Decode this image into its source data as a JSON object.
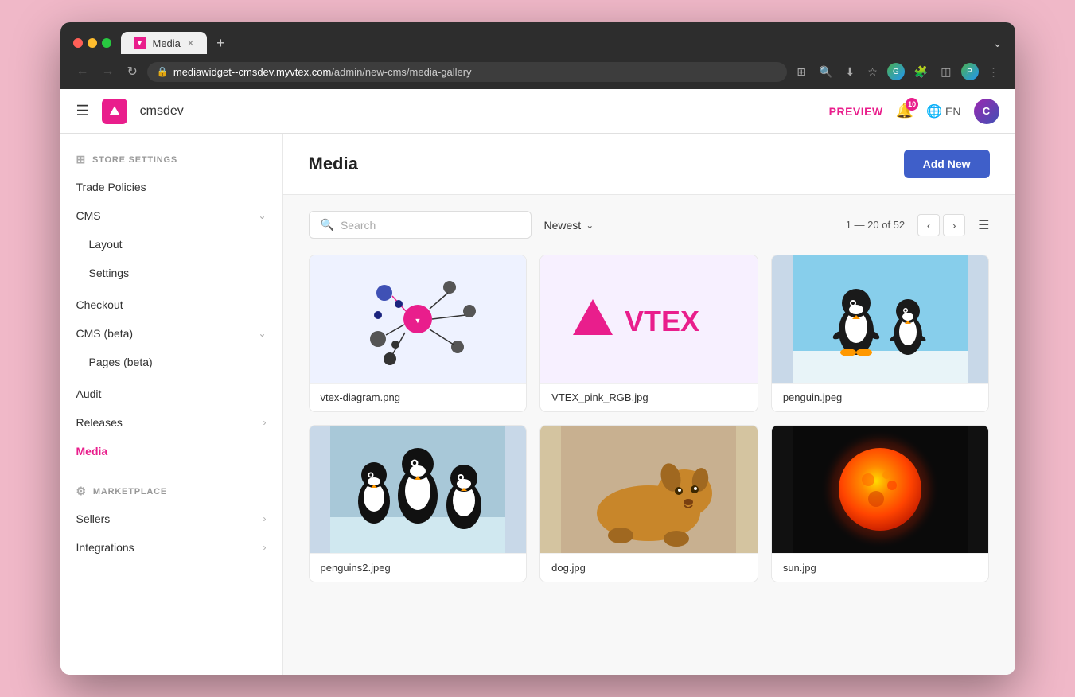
{
  "browser": {
    "tab_title": "Media",
    "tab_favicon": "▼",
    "url_domain": "mediawidget--cmsdev.myvtex.com",
    "url_path": "/admin/new-cms/media-gallery",
    "new_tab_icon": "+",
    "expand_icon": "⌄"
  },
  "nav": {
    "hamburger": "☰",
    "brand_name": "cmsdev",
    "preview_label": "PREVIEW",
    "notification_count": "10",
    "language": "EN",
    "user_initial": "C"
  },
  "sidebar": {
    "store_settings_label": "STORE SETTINGS",
    "items": [
      {
        "id": "trade-policies",
        "label": "Trade Policies",
        "has_chevron": false
      },
      {
        "id": "cms",
        "label": "CMS",
        "has_chevron": true,
        "expanded": true,
        "sub_items": [
          {
            "id": "layout",
            "label": "Layout"
          },
          {
            "id": "settings",
            "label": "Settings"
          }
        ]
      },
      {
        "id": "checkout",
        "label": "Checkout",
        "has_chevron": false
      },
      {
        "id": "cms-beta",
        "label": "CMS (beta)",
        "has_chevron": true,
        "expanded": true,
        "sub_items": [
          {
            "id": "pages-beta",
            "label": "Pages (beta)"
          }
        ]
      },
      {
        "id": "audit",
        "label": "Audit",
        "has_chevron": false
      },
      {
        "id": "releases",
        "label": "Releases",
        "has_chevron": true
      },
      {
        "id": "media",
        "label": "Media",
        "active": true,
        "has_chevron": false
      }
    ],
    "marketplace_label": "MARKETPLACE",
    "marketplace_items": [
      {
        "id": "sellers",
        "label": "Sellers",
        "has_chevron": true
      },
      {
        "id": "integrations",
        "label": "Integrations",
        "has_chevron": true
      }
    ]
  },
  "content": {
    "page_title": "Media",
    "add_new_label": "Add New",
    "search_placeholder": "Search",
    "sort_label": "Newest",
    "pagination": "1 — 20 of 52",
    "media_items": [
      {
        "id": "vtex-diagram",
        "name": "vtex-diagram.png",
        "type": "diagram"
      },
      {
        "id": "vtex-pink",
        "name": "VTEX_pink_RGB.jpg",
        "type": "vtex-logo"
      },
      {
        "id": "penguin",
        "name": "penguin.jpeg",
        "type": "penguin"
      },
      {
        "id": "penguins2",
        "name": "penguins2.jpeg",
        "type": "penguins2"
      },
      {
        "id": "dog",
        "name": "dog.jpg",
        "type": "dog"
      },
      {
        "id": "sun",
        "name": "sun.jpg",
        "type": "sun"
      }
    ]
  }
}
